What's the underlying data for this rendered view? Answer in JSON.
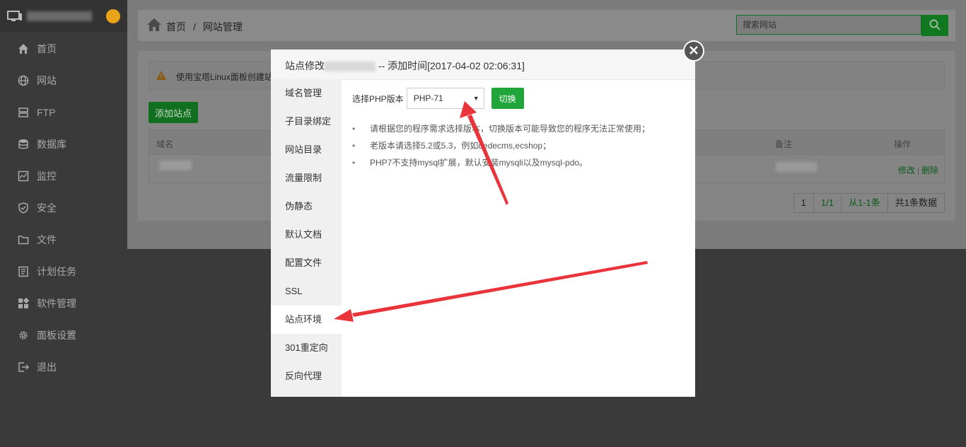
{
  "sidebar": {
    "menu": [
      {
        "label": "首页",
        "icon": "home-icon"
      },
      {
        "label": "网站",
        "icon": "globe-icon"
      },
      {
        "label": "FTP",
        "icon": "server-icon"
      },
      {
        "label": "数据库",
        "icon": "database-icon"
      },
      {
        "label": "监控",
        "icon": "monitor-chart-icon"
      },
      {
        "label": "安全",
        "icon": "shield-icon"
      },
      {
        "label": "文件",
        "icon": "folder-icon"
      },
      {
        "label": "计划任务",
        "icon": "task-list-icon"
      },
      {
        "label": "软件管理",
        "icon": "apps-icon"
      },
      {
        "label": "面板设置",
        "icon": "gear-icon"
      },
      {
        "label": "退出",
        "icon": "logout-icon"
      }
    ]
  },
  "breadcrumb": {
    "home": "首页",
    "sep": "/",
    "current": "网站管理"
  },
  "search": {
    "placeholder": "搜索网站"
  },
  "alert": {
    "text": "使用宝塔Linux面板创建站"
  },
  "add_site_label": "添加站点",
  "table": {
    "headers": {
      "domain": "域名",
      "note": "备注",
      "action": "操作"
    },
    "row": {
      "edit": "修改",
      "sep": "|",
      "delete": "删除"
    }
  },
  "pager": [
    "1",
    "1/1",
    "从1-1条",
    "共1条数据"
  ],
  "modal": {
    "title_prefix": "站点修改",
    "title_suffix": "-- 添加时间[2017-04-02 02:06:31]",
    "tabs": [
      "域名管理",
      "子目录绑定",
      "网站目录",
      "流量限制",
      "伪静态",
      "默认文档",
      "配置文件",
      "SSL",
      "站点环境",
      "301重定向",
      "反向代理"
    ],
    "active_tab": "站点环境",
    "php_label": "选择PHP版本",
    "php_value": "PHP-71",
    "switch_label": "切换",
    "notes": [
      "请根据您的程序需求选择版本，切换版本可能导致您的程序无法正常使用；",
      "老版本请选择5.2或5.3，例如dedecms,ecshop；",
      "PHP7不支持mysql扩展，默认安装mysqli以及mysql-pdo。"
    ]
  },
  "colors": {
    "accent": "#20a53a",
    "arrow": "#e8343a",
    "overlay": "#3a3a3a"
  }
}
